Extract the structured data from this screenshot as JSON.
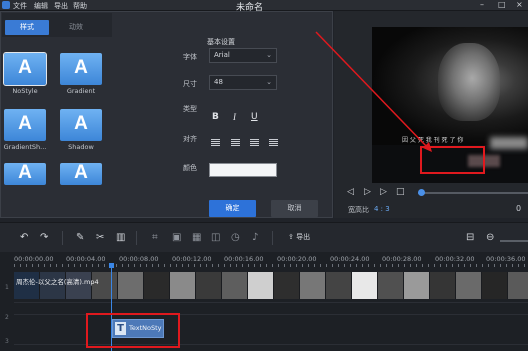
{
  "window": {
    "title": "未命名",
    "menu": [
      "文件",
      "编辑",
      "导出",
      "帮助"
    ],
    "controls": [
      "minimize-icon",
      "maximize-icon",
      "close-icon"
    ]
  },
  "text_panel": {
    "tabs": [
      {
        "label": "样式",
        "active": true
      },
      {
        "label": "动效",
        "active": false
      }
    ],
    "styles": [
      {
        "label": "NoStyle",
        "selected": true,
        "glyph": "A"
      },
      {
        "label": "Gradient",
        "selected": false,
        "glyph": "A"
      },
      {
        "label": "GradientSh...",
        "selected": false,
        "glyph": "A"
      },
      {
        "label": "Shadow",
        "selected": false,
        "glyph": "A"
      },
      {
        "label": "",
        "selected": false,
        "glyph": "A"
      },
      {
        "label": "",
        "selected": false,
        "glyph": "A"
      }
    ],
    "basic_settings_title": "基本设置",
    "font_label": "字体",
    "font_value": "Arial",
    "size_label": "尺寸",
    "size_value": "48",
    "type_label": "类型",
    "type_buttons": [
      "B",
      "I",
      "U"
    ],
    "align_label": "对齐",
    "color_label": "颜色",
    "color_value": "#f4f5f7",
    "confirm_label": "确定",
    "cancel_label": "取消"
  },
  "preview": {
    "caption_text": "因 父  死 我 刊 死 了 你",
    "aspect_label": "宽高比",
    "aspect_value": "4 : 3",
    "player_icons": [
      "prev-frame-icon",
      "play-icon",
      "next-frame-icon",
      "stop-icon"
    ]
  },
  "toolbar": {
    "export_label": "导出",
    "icons": [
      "undo-icon",
      "redo-icon",
      "pen-icon",
      "scissors-icon",
      "trash-icon",
      "crop-icon",
      "freeze-icon",
      "mosaic-icon",
      "camera-icon",
      "clock-icon",
      "mic-icon",
      "export-icon",
      "fit-icon",
      "zoom-out-icon"
    ]
  },
  "timeline": {
    "ruler_labels": [
      "00:00:00.00",
      "00:00:04.00",
      "00:00:08.00",
      "00:00:12.00",
      "00:00:16.00",
      "00:00:20.00",
      "00:00:24.00",
      "00:00:28.00",
      "00:00:32.00",
      "00:00:36.00"
    ],
    "video_clip_label": "周杰伦-以父之名(高清).mp4",
    "text_clip_label": "TextNoSty",
    "track_numbers": [
      "1",
      "2",
      "3"
    ]
  },
  "colors": {
    "accent": "#2d72d9",
    "highlight": "#e0191e",
    "panel_bg": "#2b2e35"
  }
}
